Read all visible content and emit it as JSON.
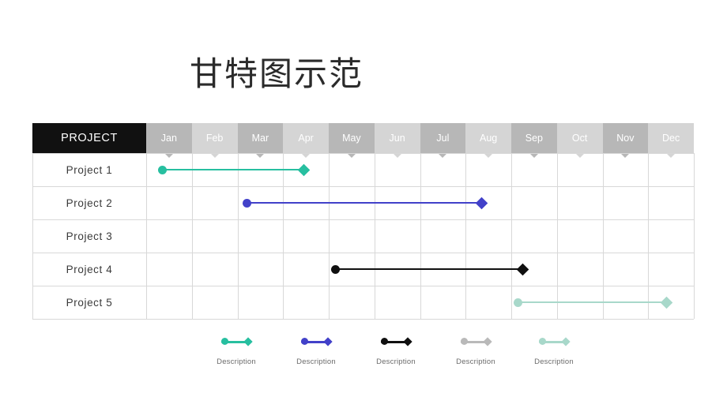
{
  "title": "甘特图示范",
  "header": {
    "project_label": "PROJECT",
    "months": [
      "Jan",
      "Feb",
      "Mar",
      "Apr",
      "May",
      "Jun",
      "Jul",
      "Aug",
      "Sep",
      "Oct",
      "Nov",
      "Dec"
    ]
  },
  "legend": [
    {
      "label": "Description",
      "color": "#27bfa0"
    },
    {
      "label": "Description",
      "color": "#4241c9"
    },
    {
      "label": "Description",
      "color": "#101010"
    },
    {
      "label": "Description",
      "color": "#b9b9b9"
    },
    {
      "label": "Description",
      "color": "#a8d8ca"
    }
  ],
  "chart_data": {
    "type": "bar",
    "subtype": "gantt",
    "title": "甘特图示范",
    "xlabel": "",
    "ylabel": "",
    "categories": [
      "Jan",
      "Feb",
      "Mar",
      "Apr",
      "May",
      "Jun",
      "Jul",
      "Aug",
      "Sep",
      "Oct",
      "Nov",
      "Dec"
    ],
    "tasks": [
      {
        "name": "Project 1",
        "start_month": "Jan",
        "end_month": "Apr",
        "start_index": 0.35,
        "end_index": 3.45,
        "color": "#27bfa0"
      },
      {
        "name": "Project 2",
        "start_month": "Mar",
        "end_month": "Aug",
        "start_index": 2.2,
        "end_index": 7.35,
        "color": "#4241c9"
      },
      {
        "name": "Project 3",
        "start_month": "",
        "end_month": "",
        "start_index": null,
        "end_index": null,
        "color": ""
      },
      {
        "name": "Project 4",
        "start_month": "May",
        "end_month": "Sep",
        "start_index": 4.15,
        "end_index": 8.25,
        "color": "#101010"
      },
      {
        "name": "Project 5",
        "start_month": "Sep",
        "end_month": "Dec",
        "start_index": 8.15,
        "end_index": 11.4,
        "color": "#a8d8ca"
      }
    ],
    "grid": true,
    "legend_position": "bottom"
  }
}
